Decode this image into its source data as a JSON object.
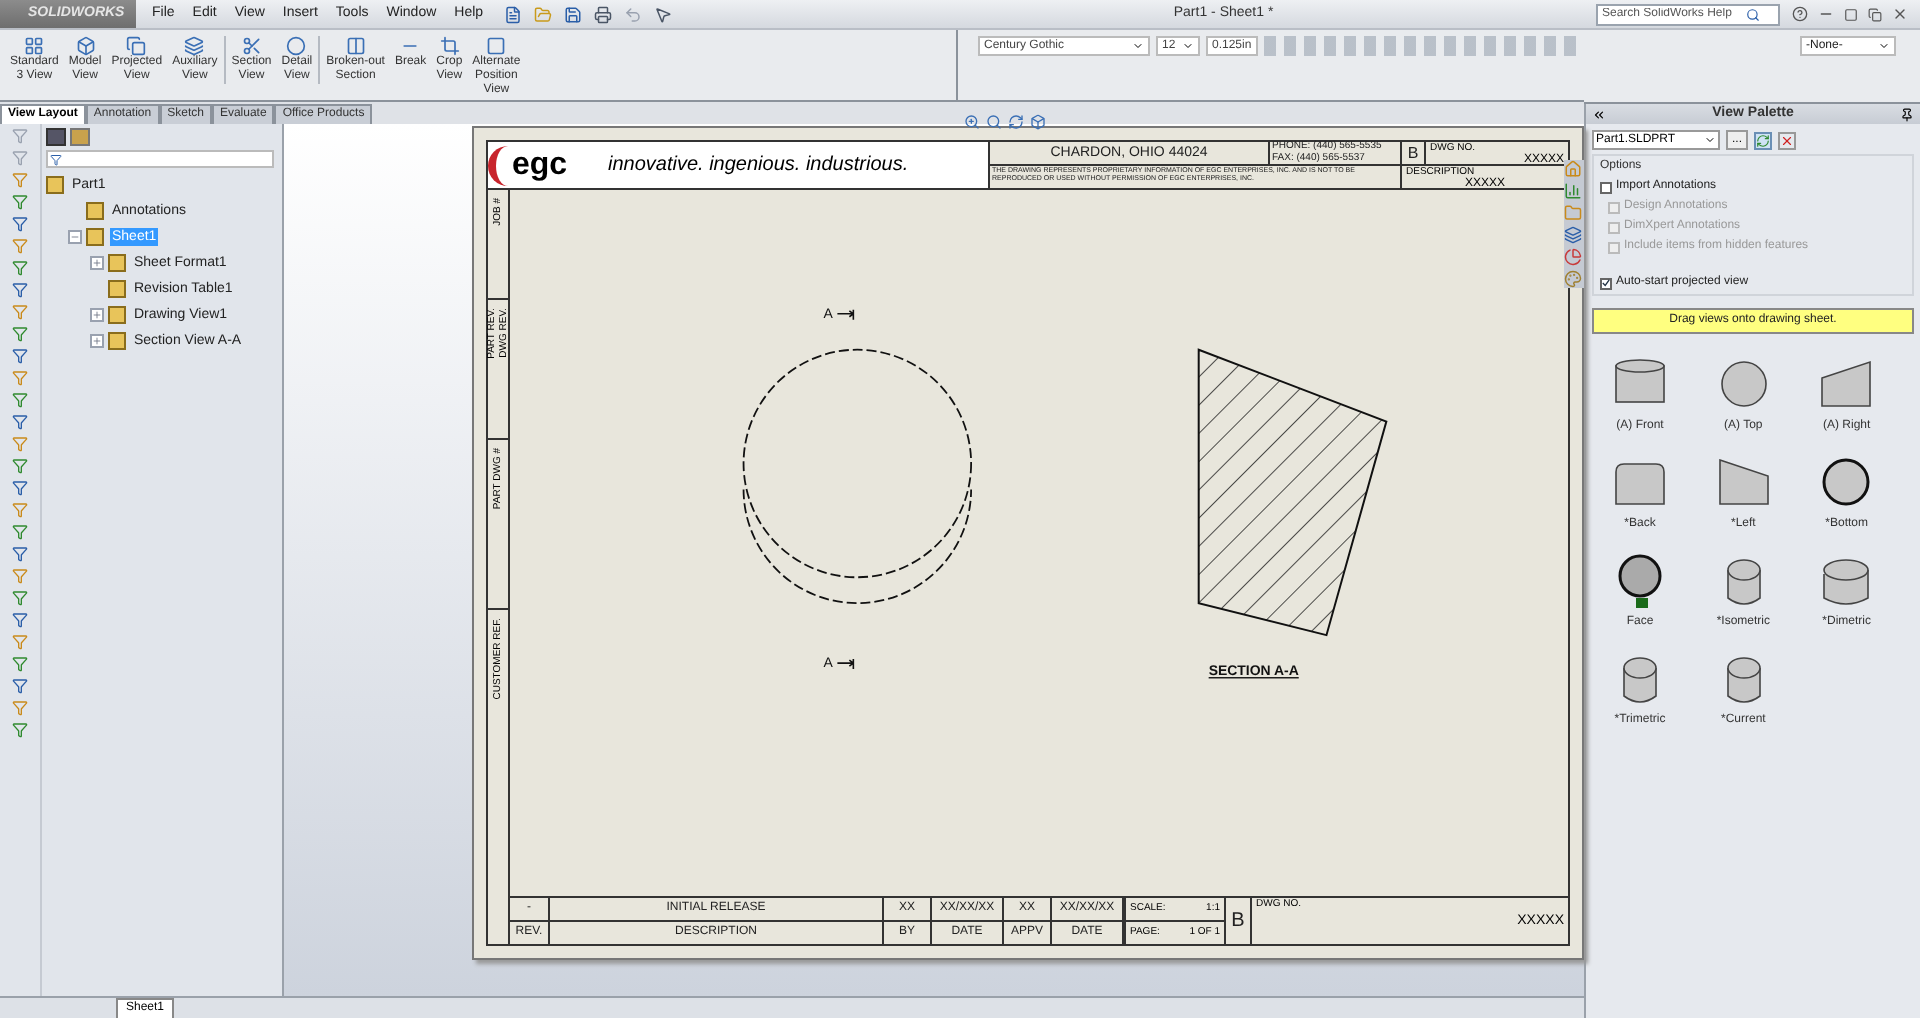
{
  "app": {
    "logo": "SOLIDWORKS",
    "menus": [
      "File",
      "Edit",
      "View",
      "Insert",
      "Tools",
      "Window",
      "Help"
    ],
    "title": "Part1 - Sheet1 *",
    "search": {
      "placeholder": "Search SolidWorks Help"
    }
  },
  "command_manager": {
    "groups": [
      [
        "Standard\n3 View",
        "Model\nView",
        "Projected\nView",
        "Auxiliary\nView"
      ],
      [
        "Section\nView",
        "Detail\nView"
      ],
      [
        "Broken-out\nSection",
        "Break",
        "Crop\nView",
        "Alternate\nPosition\nView"
      ]
    ],
    "tabs": [
      {
        "label": "View Layout",
        "selected": true
      },
      {
        "label": "Annotation",
        "selected": false
      },
      {
        "label": "Sketch",
        "selected": false
      },
      {
        "label": "Evaluate",
        "selected": false
      },
      {
        "label": "Office Products",
        "selected": false
      }
    ]
  },
  "format_toolbar": {
    "font": "Century Gothic",
    "size": "12",
    "height": "0.125in",
    "layer": "-None-"
  },
  "feature_tree": {
    "items": [
      {
        "label": "Part1",
        "selected": false,
        "children": [
          {
            "label": "Annotations",
            "selected": false
          },
          {
            "label": "Sheet1",
            "selected": true,
            "expanded": true,
            "children": [
              {
                "label": "Sheet Format1",
                "selected": false,
                "expanded": false
              },
              {
                "label": "Revision Table1",
                "selected": false
              },
              {
                "label": "Drawing View1",
                "selected": false,
                "expanded": false
              },
              {
                "label": "Section View A-A",
                "selected": false,
                "expanded": false
              }
            ]
          }
        ]
      }
    ]
  },
  "sheet": {
    "logo": "egc",
    "tagline": "innovative. ingenious. industrious.",
    "address": "CHARDON, OHIO 44024",
    "phone": "PHONE: (440) 565-5535",
    "fax": "FAX: (440) 565-5537",
    "notice": "THE DRAWING REPRESENTS PROPRIETARY INFORMATION OF EGC ENTERPRISES, INC. AND IS NOT TO BE REPRODUCED OR USED WITHOUT PERMISSION OF EGC ENTERPRISES, INC.",
    "size": "B",
    "dwg_label": "DWG NO.",
    "dwg_value": "XXXXX",
    "desc_label": "DESCRIPTION",
    "desc_value": "XXXXX",
    "side_cells": [
      [
        "JOB #"
      ],
      [
        "PART REV.",
        "DWG REV."
      ],
      [
        "PART DWG #"
      ],
      [
        "CUSTOMER REF."
      ]
    ],
    "section_marks": [
      "A",
      "A"
    ],
    "section_title": "SECTION A-A",
    "revision_row": [
      "-",
      "INITIAL RELEASE",
      "XX",
      "XX/XX/XX",
      "XX",
      "XX/XX/XX"
    ],
    "revision_headers": [
      "REV.",
      "DESCRIPTION",
      "BY",
      "DATE",
      "APPV",
      "DATE"
    ],
    "scale_label": "SCALE:",
    "scale": "1:1",
    "page_label": "PAGE:",
    "page": "1 OF 1",
    "block_size": "B",
    "block_dwg_label": "DWG NO.",
    "block_dwg_value": "XXXXX"
  },
  "view_palette": {
    "title": "View Palette",
    "document": "Part1.SLDPRT",
    "browse": "...",
    "options_title": "Options",
    "options": [
      {
        "label": "Import Annotations",
        "checked": false,
        "disabled": false
      },
      {
        "label": "Design Annotations",
        "checked": false,
        "disabled": true
      },
      {
        "label": "DimXpert Annotations",
        "checked": false,
        "disabled": true
      },
      {
        "label": "Include items from hidden features",
        "checked": false,
        "disabled": true
      },
      {
        "label": "Auto-start projected view",
        "checked": true,
        "disabled": false
      }
    ],
    "hint": "Drag views onto drawing sheet.",
    "views": [
      {
        "label": "(A) Front",
        "kind": "cylinder"
      },
      {
        "label": "(A) Top",
        "kind": "circle"
      },
      {
        "label": "(A) Right",
        "kind": "wedge"
      },
      {
        "label": "*Back",
        "kind": "rounded"
      },
      {
        "label": "*Left",
        "kind": "wedge-left"
      },
      {
        "label": "*Bottom",
        "kind": "circle-bold"
      },
      {
        "label": "Face",
        "kind": "face"
      },
      {
        "label": "*Isometric",
        "kind": "iso"
      },
      {
        "label": "*Dimetric",
        "kind": "iso-wide"
      },
      {
        "label": "*Trimetric",
        "kind": "iso"
      },
      {
        "label": "*Current",
        "kind": "iso"
      }
    ]
  },
  "status_bar": {
    "sheet_tab": "Sheet1"
  }
}
